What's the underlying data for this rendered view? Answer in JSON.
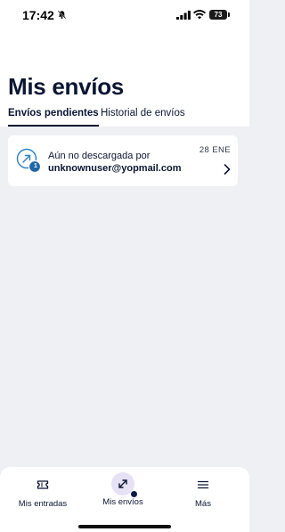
{
  "status_bar": {
    "time": "17:42",
    "battery": "73"
  },
  "page": {
    "title": "Mis envíos"
  },
  "tabs": [
    {
      "label": "Envíos pendientes",
      "active": true
    },
    {
      "label": "Historial de envíos",
      "active": false
    }
  ],
  "transfer": {
    "status": "Aún no descargada por",
    "recipient": "unknownuser@yopmail.com",
    "date": "28 ENE",
    "count": "1",
    "icon": "outgoing-arrow-icon"
  },
  "bottom_nav": [
    {
      "label": "Mis entradas",
      "icon": "ticket-icon",
      "active": false
    },
    {
      "label": "Mis envíos",
      "icon": "transfer-arrows-icon",
      "active": true
    },
    {
      "label": "Más",
      "icon": "menu-icon",
      "active": false
    }
  ],
  "colors": {
    "primary": "#0b1633",
    "accent": "#2d7fbf",
    "background": "#eef0f4",
    "active_nav_bg": "#e7e1f6"
  }
}
